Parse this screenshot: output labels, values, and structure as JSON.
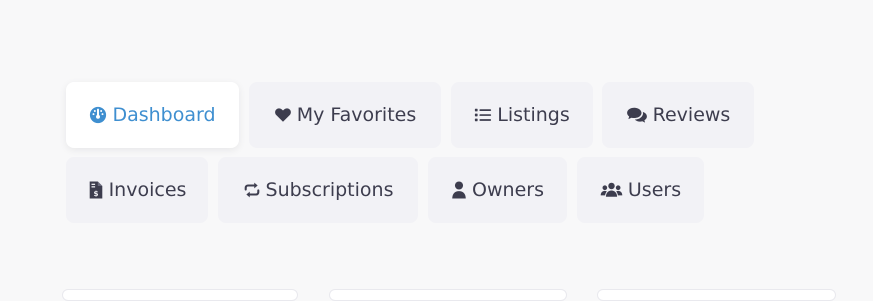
{
  "nav": {
    "tabs": [
      {
        "label": "Dashboard",
        "icon": "dashboard-icon",
        "active": true
      },
      {
        "label": "My Favorites",
        "icon": "heart-icon",
        "active": false
      },
      {
        "label": "Listings",
        "icon": "list-icon",
        "active": false
      },
      {
        "label": "Reviews",
        "icon": "comments-icon",
        "active": false
      },
      {
        "label": "Invoices",
        "icon": "invoice-icon",
        "active": false
      },
      {
        "label": "Subscriptions",
        "icon": "repeat-icon",
        "active": false
      },
      {
        "label": "Owners",
        "icon": "user-icon",
        "active": false
      },
      {
        "label": "Users",
        "icon": "users-icon",
        "active": false
      }
    ]
  },
  "colors": {
    "accent": "#3f8fd0",
    "tab_background": "#f2f2f6",
    "active_tab_background": "#ffffff",
    "text": "#3d3d4e",
    "page_background": "#f8f8f9"
  }
}
